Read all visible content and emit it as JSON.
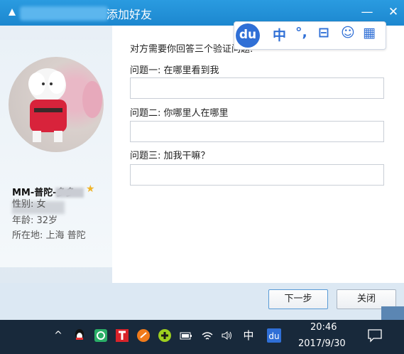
{
  "window": {
    "title": "添加好友",
    "minimize": "—",
    "close": "✕"
  },
  "profile": {
    "nickname": "MM-普陀-多多",
    "gender": "性别: 女",
    "age": "年龄: 32岁",
    "location": "所在地: 上海  普陀"
  },
  "form": {
    "instruction": "对方需要你回答三个验证问题:",
    "questions": [
      {
        "label": "问题一: 在哪里看到我",
        "answer": ""
      },
      {
        "label": "问题二: 你哪里人在哪里",
        "answer": ""
      },
      {
        "label": "问题三: 加我干嘛？",
        "answer": ""
      }
    ]
  },
  "ime_toolbar": {
    "logo": "du",
    "items": [
      "中",
      "°,",
      "⊟",
      "☺",
      "▦"
    ]
  },
  "buttons": {
    "next": "下一步",
    "close": "关闭"
  },
  "taskbar": {
    "ime_mode": "中",
    "time": "20:46",
    "date": "2017/9/30"
  },
  "colors": {
    "titlebar": "#1c87cf",
    "taskbar": "#18293b",
    "ime_blue": "#2f6fd6"
  }
}
